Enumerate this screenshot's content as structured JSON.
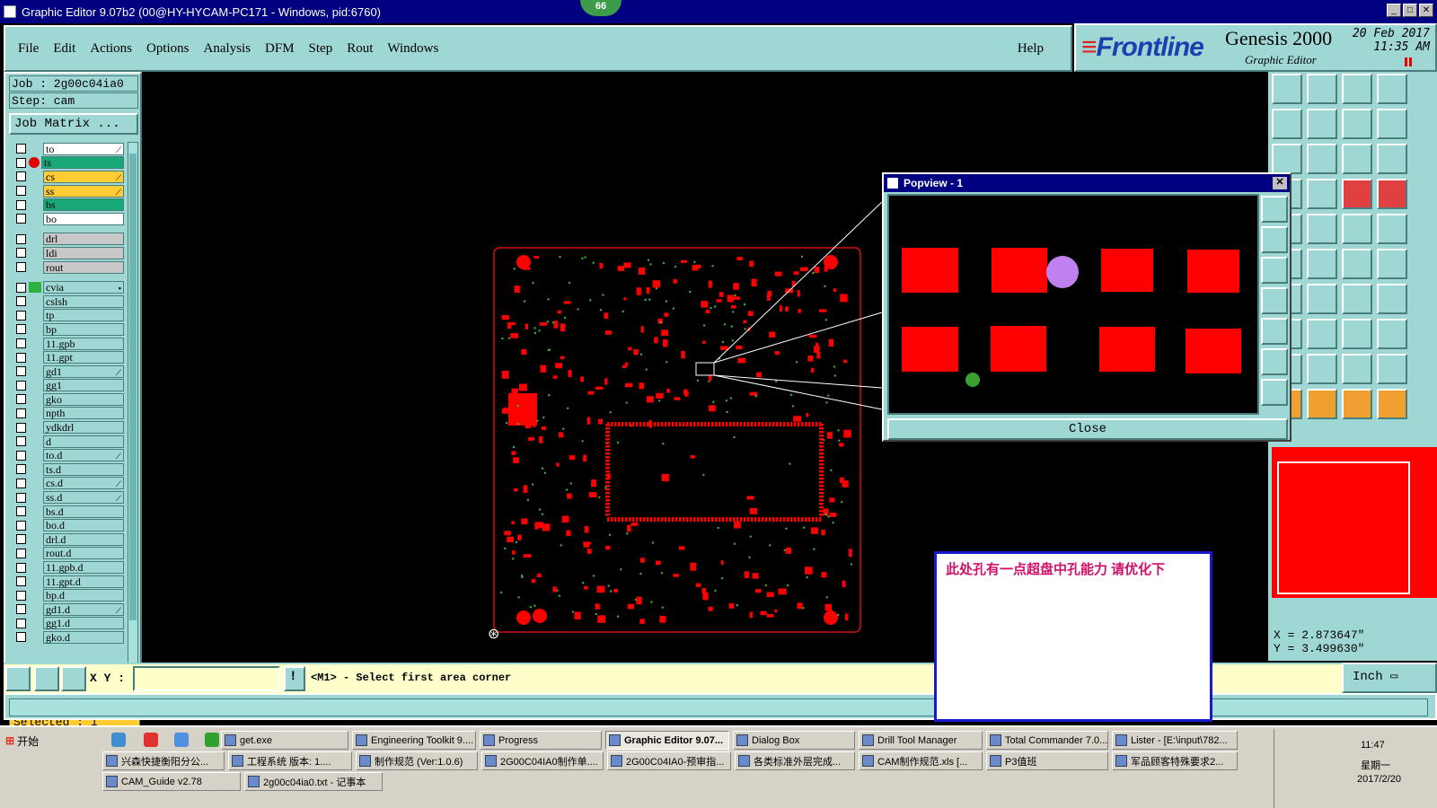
{
  "window": {
    "title": "Graphic Editor 9.07b2 (00@HY-HYCAM-PC171 - Windows, pid:6760)",
    "min": "_",
    "max": "□",
    "close": "✕",
    "badge": "66"
  },
  "menu": [
    "File",
    "Edit",
    "Actions",
    "Options",
    "Analysis",
    "DFM",
    "Step",
    "Rout",
    "Windows"
  ],
  "help": "Help",
  "brand": {
    "logo": "Frontline",
    "product": "Genesis 2000",
    "sub": "Graphic Editor",
    "date": "20 Feb 2017",
    "time": "11:35 AM"
  },
  "job": {
    "job": "Job  : 2g00c04ia0",
    "step": "Step: cam",
    "matrix_btn": "Job Matrix ..."
  },
  "layer_groups": [
    [
      {
        "n": "to",
        "c": "#ffffff",
        "i": "⟋"
      },
      {
        "n": "ts",
        "c": "#18a878",
        "dot": true
      },
      {
        "n": "cs",
        "c": "#ffcc33",
        "i": "⟋"
      },
      {
        "n": "ss",
        "c": "#ffcc33",
        "i": "⟋"
      },
      {
        "n": "bs",
        "c": "#18a878"
      },
      {
        "n": "bo",
        "c": "#ffffff"
      }
    ],
    [
      {
        "n": "drl",
        "c": "#c8c8c8"
      },
      {
        "n": "ldi",
        "c": "#c8c8c8"
      },
      {
        "n": "rout",
        "c": "#c8c8c8"
      }
    ],
    [
      {
        "n": "cvia",
        "c": "#9fd7d4",
        "edit": true,
        "i": "▪"
      },
      {
        "n": "cslsh"
      },
      {
        "n": "tp"
      },
      {
        "n": "bp"
      },
      {
        "n": "11.gpb"
      },
      {
        "n": "11.gpt"
      },
      {
        "n": "gd1",
        "i": "⟋"
      },
      {
        "n": "gg1"
      },
      {
        "n": "gko"
      },
      {
        "n": "npth"
      },
      {
        "n": "ydkdrl"
      },
      {
        "n": "d"
      },
      {
        "n": "to.d",
        "i": "⟋"
      },
      {
        "n": "ts.d"
      },
      {
        "n": "cs.d",
        "i": "⟋"
      },
      {
        "n": "ss.d",
        "i": "⟋"
      },
      {
        "n": "bs.d"
      },
      {
        "n": "bo.d"
      },
      {
        "n": "drl.d"
      },
      {
        "n": "rout.d"
      },
      {
        "n": "11.gpb.d"
      },
      {
        "n": "11.gpt.d"
      },
      {
        "n": "bp.d"
      },
      {
        "n": "gd1.d",
        "i": "⟋"
      },
      {
        "n": "gg1.d"
      },
      {
        "n": "gko.d"
      }
    ]
  ],
  "selected": "Selected : 1",
  "popview": {
    "title": "Popview - 1",
    "close": "Close"
  },
  "cmd": {
    "xy_label": "X Y :",
    "xy_value": "",
    "message": "<M1> - Select first area corner"
  },
  "units": "Inch ▭",
  "coords": {
    "x": "X  =  2.873647\"",
    "y": "Y  =  3.499630\""
  },
  "note": "此处孔有一点超盘中孔能力    请优化下",
  "colors": {
    "title_blue": "#000080",
    "panel": "#9fd7d4",
    "pad_red": "#ff0000",
    "note_border": "#1818d0",
    "note_text": "#d0106a"
  },
  "taskbar": {
    "start": "开始",
    "row1": [
      "get.exe",
      "Engineering Toolkit 9....",
      "Progress",
      "Graphic Editor 9.07...",
      "Dialog Box",
      "Drill Tool Manager",
      "Total Commander 7.0...",
      "Lister - [E:\\input\\782..."
    ],
    "row2": [
      "兴森快捷衡阳分公...",
      "工程系统  版本: 1....",
      "制作规范 (Ver:1.0.6)",
      "2G00C04IA0制作单....",
      "2G00C04IA0-预审指...",
      "各类标准外层完成...",
      "CAM制作规范.xls  [...",
      "P3值班",
      "军品顾客特殊要求2..."
    ],
    "row3": [
      "CAM_Guide v2.78",
      "2g00c04ia0.txt - 记事本"
    ],
    "time": "11:47",
    "weekday": "星期一",
    "date": "2017/2/20"
  }
}
